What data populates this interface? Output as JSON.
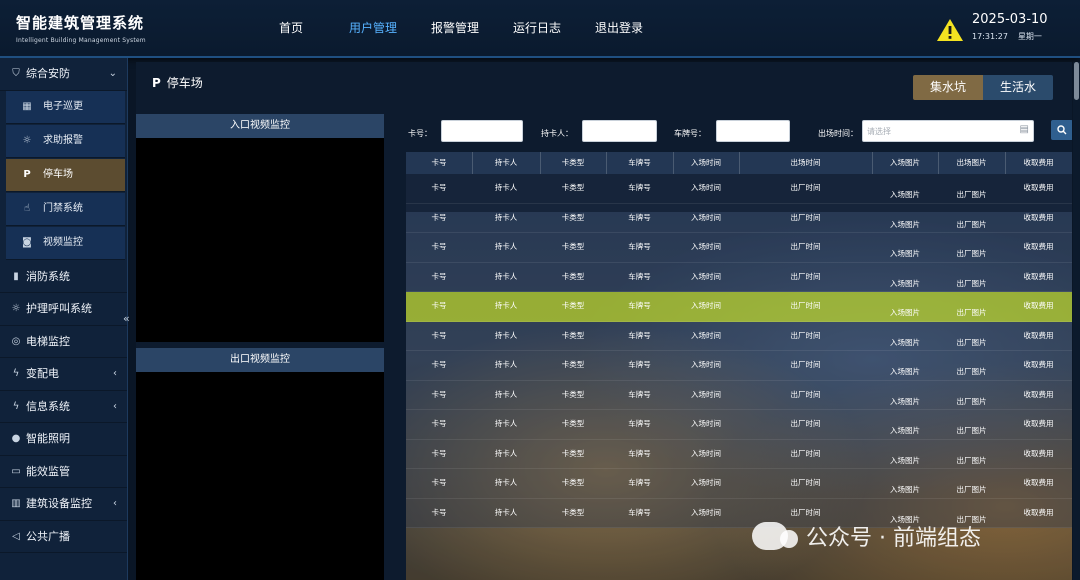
{
  "header": {
    "title": "智能建筑管理系统",
    "subtitle": "Intelligent Building Management System",
    "nav": [
      "首页",
      "用户管理",
      "报警管理",
      "运行日志",
      "退出登录"
    ],
    "active_nav": 1,
    "date": "2025-03-10",
    "time": "17:31:27",
    "weekday": "星期一",
    "warning_color": "#f4e321"
  },
  "sidebar": {
    "items": [
      {
        "label": "综合安防",
        "icon": "shield-icon",
        "chevron": "⌄"
      },
      {
        "label": "电子巡更",
        "icon": "patrol-icon",
        "sub": true
      },
      {
        "label": "求助报警",
        "icon": "alarm-light-icon",
        "sub": true
      },
      {
        "label": "停车场",
        "icon": "parking-icon",
        "sub": true,
        "active": true
      },
      {
        "label": "门禁系统",
        "icon": "hand-icon",
        "sub": true
      },
      {
        "label": "视频监控",
        "icon": "camera-icon",
        "sub": true
      },
      {
        "label": "消防系统",
        "icon": "fire-extinguisher-icon"
      },
      {
        "label": "护理呼叫系统",
        "icon": "call-light-icon"
      },
      {
        "label": "电梯监控",
        "icon": "elevator-icon"
      },
      {
        "label": "变配电",
        "icon": "lightning-icon",
        "chevron": "‹"
      },
      {
        "label": "信息系统",
        "icon": "lightning-icon",
        "chevron": "‹"
      },
      {
        "label": "智能照明",
        "icon": "bulb-icon"
      },
      {
        "label": "能效监管",
        "icon": "gauge-icon"
      },
      {
        "label": "建筑设备监控",
        "icon": "building-icon",
        "chevron": "‹"
      },
      {
        "label": "公共广播",
        "icon": "speaker-icon"
      }
    ],
    "collapse_glyph": "«"
  },
  "page": {
    "title": "停车场",
    "tabs": [
      "集水坑",
      "生活水"
    ],
    "entry_video": "入口视频监控",
    "exit_video": "出口视频监控"
  },
  "filters": {
    "card_label": "卡号：",
    "holder_label": "持卡人：",
    "plate_label": "车牌号：",
    "exit_time_label": "出场时间：",
    "exit_time_placeholder": "请选择"
  },
  "table": {
    "columns": [
      "卡号",
      "持卡人",
      "卡类型",
      "车牌号",
      "入场时间",
      "出场时间",
      "入场图片",
      "出场图片",
      "收取费用"
    ],
    "rows": [
      [
        "卡号",
        "持卡人",
        "卡类型",
        "车牌号",
        "入场时间",
        "出厂时间",
        "入场图片",
        "出厂图片",
        "收取费用"
      ],
      [
        "卡号",
        "持卡人",
        "卡类型",
        "车牌号",
        "入场时间",
        "出厂时间",
        "入场图片",
        "出厂图片",
        "收取费用"
      ],
      [
        "卡号",
        "持卡人",
        "卡类型",
        "车牌号",
        "入场时间",
        "出厂时间",
        "入场图片",
        "出厂图片",
        "收取费用"
      ],
      [
        "卡号",
        "持卡人",
        "卡类型",
        "车牌号",
        "入场时间",
        "出厂时间",
        "入场图片",
        "出厂图片",
        "收取费用"
      ],
      [
        "卡号",
        "持卡人",
        "卡类型",
        "车牌号",
        "入场时间",
        "出厂时间",
        "入场图片",
        "出厂图片",
        "收取费用"
      ],
      [
        "卡号",
        "持卡人",
        "卡类型",
        "车牌号",
        "入场时间",
        "出厂时间",
        "入场图片",
        "出厂图片",
        "收取费用"
      ],
      [
        "卡号",
        "持卡人",
        "卡类型",
        "车牌号",
        "入场时间",
        "出厂时间",
        "入场图片",
        "出厂图片",
        "收取费用"
      ],
      [
        "卡号",
        "持卡人",
        "卡类型",
        "车牌号",
        "入场时间",
        "出厂时间",
        "入场图片",
        "出厂图片",
        "收取费用"
      ],
      [
        "卡号",
        "持卡人",
        "卡类型",
        "车牌号",
        "入场时间",
        "出厂时间",
        "入场图片",
        "出厂图片",
        "收取费用"
      ],
      [
        "卡号",
        "持卡人",
        "卡类型",
        "车牌号",
        "入场时间",
        "出厂时间",
        "入场图片",
        "出厂图片",
        "收取费用"
      ],
      [
        "卡号",
        "持卡人",
        "卡类型",
        "车牌号",
        "入场时间",
        "出厂时间",
        "入场图片",
        "出厂图片",
        "收取费用"
      ],
      [
        "卡号",
        "持卡人",
        "卡类型",
        "车牌号",
        "入场时间",
        "出厂时间",
        "入场图片",
        "出厂图片",
        "收取费用"
      ]
    ],
    "highlight_row": 4,
    "highlight_color": "#bed728"
  },
  "watermark": "公众号 · 前端组态"
}
